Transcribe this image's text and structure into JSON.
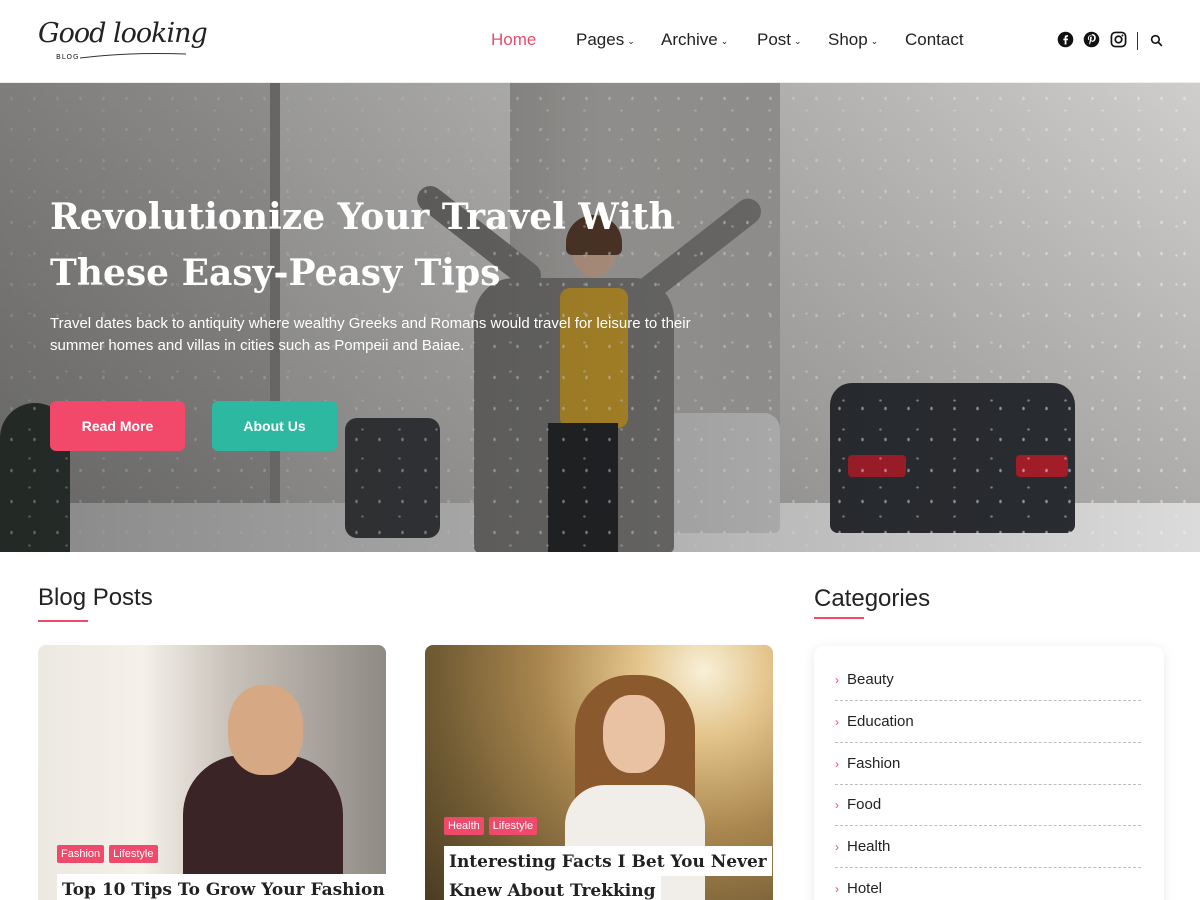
{
  "logo": {
    "script": "Good looking",
    "sub": "BLOG"
  },
  "nav": {
    "items": [
      {
        "label": "Home",
        "active": true,
        "dropdown": false
      },
      {
        "label": "Pages",
        "active": false,
        "dropdown": true
      },
      {
        "label": "Archive",
        "active": false,
        "dropdown": true
      },
      {
        "label": "Post",
        "active": false,
        "dropdown": true
      },
      {
        "label": "Shop",
        "active": false,
        "dropdown": true
      },
      {
        "label": "Contact",
        "active": false,
        "dropdown": false
      }
    ],
    "icons": [
      "facebook-icon",
      "pinterest-icon",
      "instagram-icon",
      "search-icon"
    ]
  },
  "hero": {
    "title": "Revolutionize Your Travel With These Easy-Peasy Tips",
    "text": "Travel dates back to antiquity where wealthy Greeks and Romans would travel for leisure to their summer homes and villas in cities such as Pompeii and Baiae.",
    "read_more": "Read More",
    "about_us": "About Us"
  },
  "blog": {
    "title": "Blog Posts",
    "posts": [
      {
        "tags": [
          "Fashion",
          "Lifestyle"
        ],
        "title": "Top 10 Tips To Grow Your Fashion"
      },
      {
        "tags": [
          "Health",
          "Lifestyle"
        ],
        "title_line1": "Interesting Facts I Bet You Never",
        "title_line2": "Knew About Trekking"
      }
    ]
  },
  "categories": {
    "title": "Categories",
    "items": [
      "Beauty",
      "Education",
      "Fashion",
      "Food",
      "Health",
      "Hotel"
    ]
  },
  "colors": {
    "accent": "#ef4a6b",
    "teal": "#2db8a1"
  }
}
